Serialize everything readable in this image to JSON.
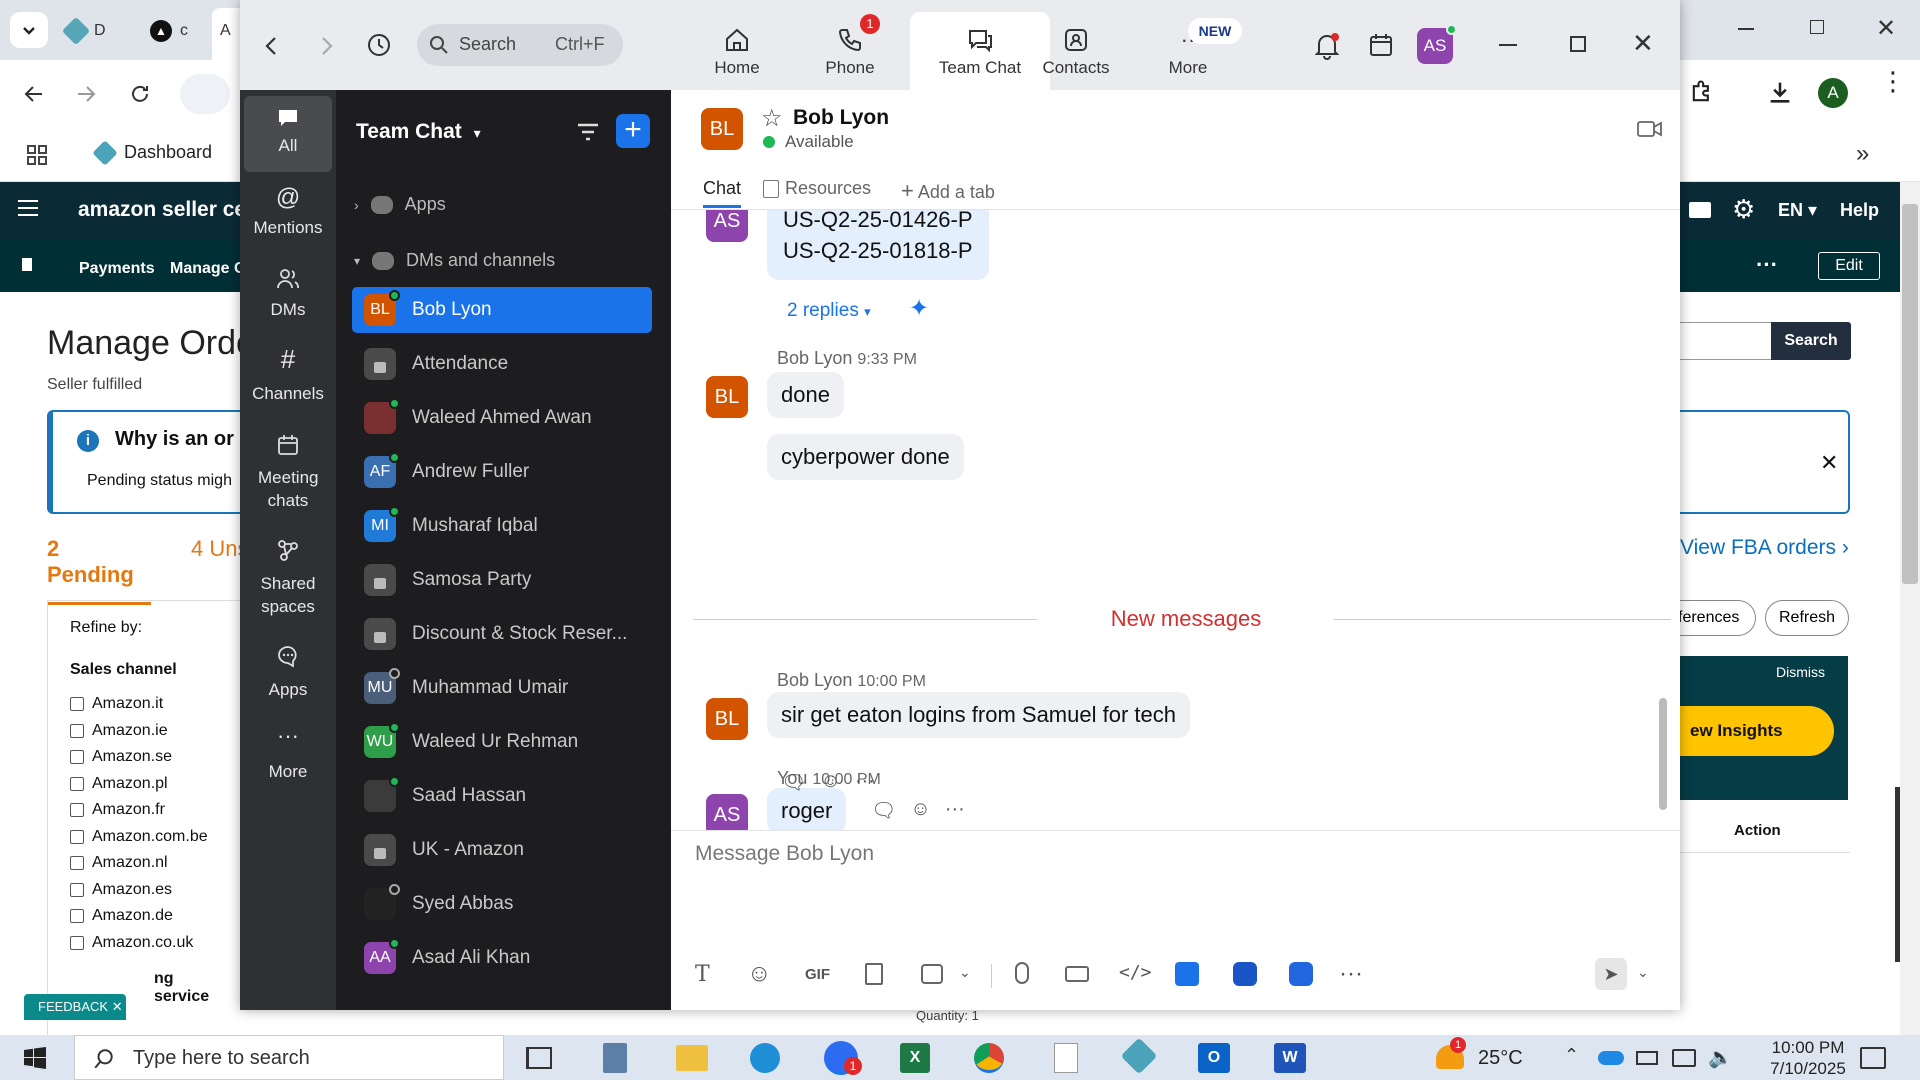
{
  "browser": {
    "tab1_label": "D",
    "tab2_label": "c",
    "tab3_label": "A",
    "bookmark_dashboard": "Dashboard",
    "profile_initial": "A",
    "amazon_logo": "amazon seller centr",
    "nav_lang": "EN",
    "nav_help": "Help",
    "sub_payments": "Payments",
    "sub_manage": "Manage C",
    "sub_edit": "Edit",
    "page_title": "Manage Orde",
    "page_subtitle": "Seller fulfilled",
    "info_title": "Why is an or",
    "info_text": "Pending status migh",
    "tab_pending": "2 Pending",
    "tab_unshipped": "4 Uns",
    "refine_by": "Refine by:",
    "sales_channel": "Sales channel",
    "channels": [
      "Amazon.it",
      "Amazon.ie",
      "Amazon.se",
      "Amazon.pl",
      "Amazon.fr",
      "Amazon.com.be",
      "Amazon.nl",
      "Amazon.es",
      "Amazon.de",
      "Amazon.co.uk"
    ],
    "service_label": "ng service",
    "feedback": "FEEDBACK",
    "search_button": "Search",
    "view_fba": "View FBA orders",
    "preferences": "ferences",
    "refresh": "Refresh",
    "dismiss": "Dismiss",
    "insights": "ew Insights",
    "action_header": "Action",
    "quantity": "Quantity: 1"
  },
  "zoom": {
    "search_label": "Search",
    "search_shortcut": "Ctrl+F",
    "tabs": [
      {
        "label": "Home"
      },
      {
        "label": "Phone",
        "badge": "1"
      },
      {
        "label": "Team Chat"
      },
      {
        "label": "Contacts"
      },
      {
        "label": "More",
        "badge": "NEW"
      }
    ],
    "user_initials": "AS",
    "rail": [
      "All",
      "Mentions",
      "DMs",
      "Channels",
      "Meeting chats",
      "Shared spaces",
      "Apps",
      "More"
    ],
    "panel_title": "Team Chat",
    "section_apps": "Apps",
    "section_dms": "DMs and channels",
    "dms": [
      {
        "name": "Bob Lyon",
        "initials": "BL",
        "color": "#d35400",
        "presence": "online"
      },
      {
        "name": "Attendance",
        "initials": "",
        "color": "#4a4a4a",
        "presence": "lock"
      },
      {
        "name": "Waleed Ahmed Awan",
        "initials": "",
        "color": "#7a3030",
        "presence": "online"
      },
      {
        "name": "Andrew Fuller",
        "initials": "AF",
        "color": "#3a6fb0",
        "presence": "online"
      },
      {
        "name": "Musharaf Iqbal",
        "initials": "MI",
        "color": "#1f7ad8",
        "presence": "online"
      },
      {
        "name": "Samosa Party",
        "initials": "",
        "color": "#4a4a4a",
        "presence": "lock"
      },
      {
        "name": "Discount & Stock Reser...",
        "initials": "",
        "color": "#4a4a4a",
        "presence": "lock"
      },
      {
        "name": "Muhammad Umair",
        "initials": "MU",
        "color": "#4b5e7a",
        "presence": "away"
      },
      {
        "name": "Waleed Ur Rehman",
        "initials": "WU",
        "color": "#2e9e4a",
        "presence": "online"
      },
      {
        "name": "Saad Hassan",
        "initials": "",
        "color": "#3b3b3b",
        "presence": "online"
      },
      {
        "name": "UK - Amazon",
        "initials": "",
        "color": "#4a4a4a",
        "presence": "lock"
      },
      {
        "name": "Syed Abbas",
        "initials": "",
        "color": "#222",
        "presence": "away"
      },
      {
        "name": "Asad Ali Khan",
        "initials": "AA",
        "color": "#8e44ad",
        "presence": "online"
      }
    ],
    "chat": {
      "contact_name": "Bob Lyon",
      "contact_initials": "BL",
      "status": "Available",
      "tab_chat": "Chat",
      "tab_resources": "Resources",
      "tab_add": "Add a tab",
      "prev_line1": "US-Q2-25-01426-P",
      "prev_line2": "US-Q2-25-01818-P",
      "replies": "2 replies",
      "msg1_sender": "Bob Lyon",
      "msg1_time": "9:33 PM",
      "msg1_a": "done",
      "msg1_b": "cyberpower done",
      "new_messages": "New messages",
      "msg2_sender": "Bob Lyon",
      "msg2_time": "10:00 PM",
      "msg2_text": "sir get eaton logins from Samuel for tech",
      "msg3_sender": "You",
      "msg3_time": "10:00 PM",
      "msg3_text": "roger",
      "composer_placeholder": "Message Bob Lyon"
    }
  },
  "taskbar": {
    "search_placeholder": "Type here to search",
    "temperature": "25°C",
    "weather_badge": "1",
    "zoom_badge": "1",
    "time": "10:00 PM",
    "date": "7/10/2025"
  },
  "colors": {
    "zoom_blue": "#1a73e8",
    "amazon_nav": "#0a2b36",
    "available_green": "#1db954",
    "new_messages_red": "#d32f2f"
  }
}
